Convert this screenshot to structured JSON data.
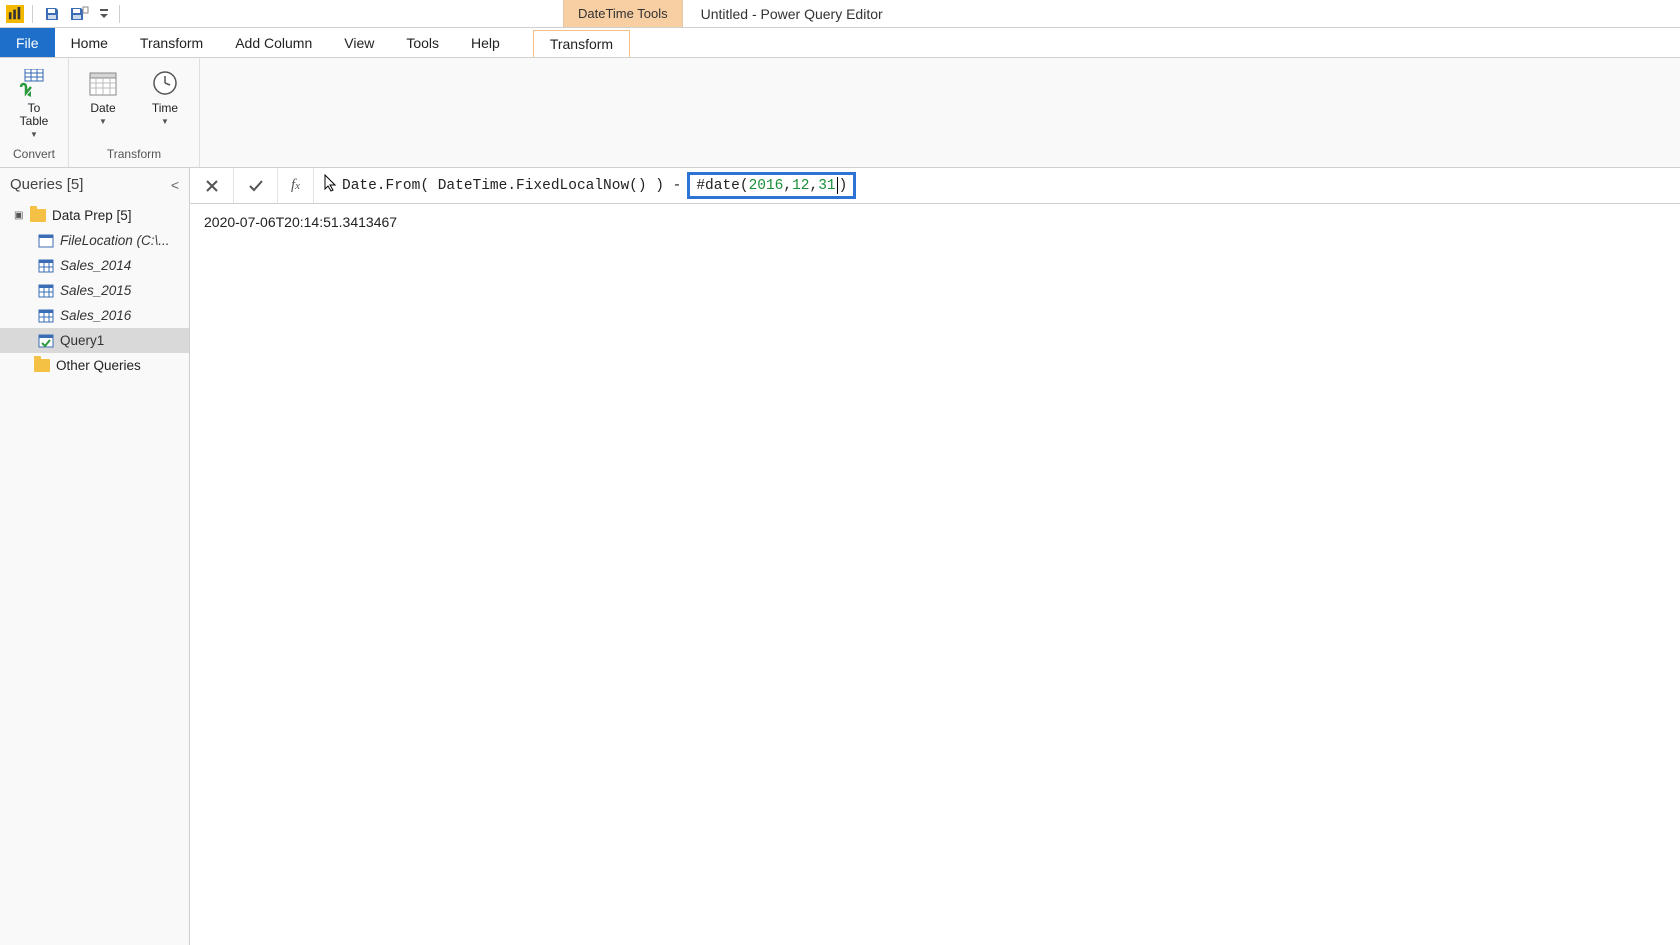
{
  "titlebar": {
    "context_label": "DateTime Tools",
    "app_title": "Untitled - Power Query Editor"
  },
  "tabs": {
    "file": "File",
    "home": "Home",
    "transform": "Transform",
    "add_column": "Add Column",
    "view": "View",
    "tools": "Tools",
    "help": "Help",
    "context_transform": "Transform"
  },
  "ribbon": {
    "to_table": "To\nTable",
    "date": "Date",
    "time": "Time",
    "group_convert": "Convert",
    "group_transform": "Transform"
  },
  "queries": {
    "header": "Queries [5]",
    "group_data_prep": "Data Prep [5]",
    "item_file_location": "FileLocation (C:\\...",
    "item_sales_2014": "Sales_2014",
    "item_sales_2015": "Sales_2015",
    "item_sales_2016": "Sales_2016",
    "item_query1": "Query1",
    "group_other": "Other Queries"
  },
  "formula": {
    "plain": "Date.From( DateTime.FixedLocalNow() ) -",
    "hl_prefix": "#date",
    "hl_paren_open": "(",
    "hl_y": "2016",
    "hl_c1": ", ",
    "hl_m": "12",
    "hl_c2": ", ",
    "hl_d": "31",
    "hl_paren_close": ")"
  },
  "result": "2020-07-06T20:14:51.3413467"
}
